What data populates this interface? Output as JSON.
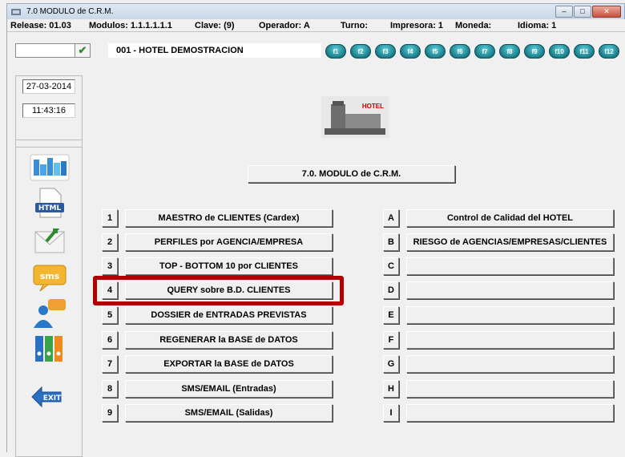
{
  "window": {
    "title": "7.0  MODULO de C.R.M.",
    "minimize_label": "–",
    "maximize_label": "□",
    "close_label": "✕"
  },
  "statusbar": {
    "release": "Release:  01.03",
    "modulos": "Modulos:  1.1.1.1.1.1",
    "clave": "Clave:    (9)",
    "operador": "Operador:  A",
    "turno": "Turno:",
    "impresora": "Impresora: 1",
    "moneda": "Moneda:",
    "idioma": "Idioma:   1"
  },
  "toolbar": {
    "input_value": "",
    "check_label": "✔",
    "hotel_name": "001 - HOTEL DEMOSTRACION",
    "function_keys": [
      "f1",
      "f2",
      "f3",
      "f4",
      "f5",
      "f6",
      "f7",
      "f8",
      "f9",
      "f10",
      "f11",
      "f12"
    ]
  },
  "datetime": {
    "date": "27-03-2014",
    "time": "11:43:16"
  },
  "sidebar_icons": [
    {
      "name": "vcds-icon"
    },
    {
      "name": "html-icon"
    },
    {
      "name": "mail-send-icon"
    },
    {
      "name": "sms-icon"
    },
    {
      "name": "users-chat-icon"
    },
    {
      "name": "binders-icon"
    },
    {
      "name": "exit-icon"
    }
  ],
  "logo": {
    "text": "HOTEL"
  },
  "module_title": "7.0.  MODULO de C.R.M.",
  "main_options": [
    {
      "key": "1",
      "label": "MAESTRO de CLIENTES (Cardex)"
    },
    {
      "key": "2",
      "label": "PERFILES por AGENCIA/EMPRESA"
    },
    {
      "key": "3",
      "label": "TOP - BOTTOM 10 por CLIENTES"
    },
    {
      "key": "4",
      "label": "QUERY sobre B.D. CLIENTES"
    },
    {
      "key": "5",
      "label": "DOSSIER de ENTRADAS PREVISTAS"
    },
    {
      "key": "6",
      "label": "REGENERAR la BASE de DATOS"
    },
    {
      "key": "7",
      "label": "EXPORTAR la BASE de DATOS"
    },
    {
      "key": "8",
      "label": "SMS/EMAIL (Entradas)"
    },
    {
      "key": "9",
      "label": "SMS/EMAIL (Salidas)"
    }
  ],
  "side_options": [
    {
      "key": "A",
      "label": "Control  de  Calidad  del  HOTEL"
    },
    {
      "key": "B",
      "label": "RIESGO de AGENCIAS/EMPRESAS/CLIENTES"
    },
    {
      "key": "C",
      "label": ""
    },
    {
      "key": "D",
      "label": ""
    },
    {
      "key": "E",
      "label": ""
    },
    {
      "key": "F",
      "label": ""
    },
    {
      "key": "G",
      "label": ""
    },
    {
      "key": "H",
      "label": ""
    },
    {
      "key": "I",
      "label": ""
    }
  ]
}
